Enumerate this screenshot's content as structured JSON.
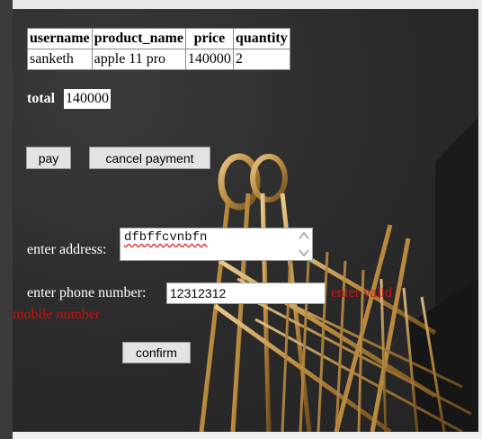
{
  "cart_table": {
    "headers": [
      "username",
      "product_name",
      "price",
      "quantity"
    ],
    "rows": [
      [
        "sanketh",
        "apple 11 pro",
        "140000",
        "2"
      ]
    ]
  },
  "total": {
    "label": "total",
    "value": "140000"
  },
  "buttons": {
    "pay": "pay",
    "cancel_payment": "cancel payment",
    "confirm": "confirm"
  },
  "address": {
    "label": "enter address:",
    "value": "dfbffcvnbfn"
  },
  "phone": {
    "label": "enter phone number:",
    "value": "12312312",
    "error_line1": "enter valid",
    "error_line2": "mobile number"
  },
  "colors": {
    "error": "#cc1111",
    "label_text": "#ffffff"
  }
}
